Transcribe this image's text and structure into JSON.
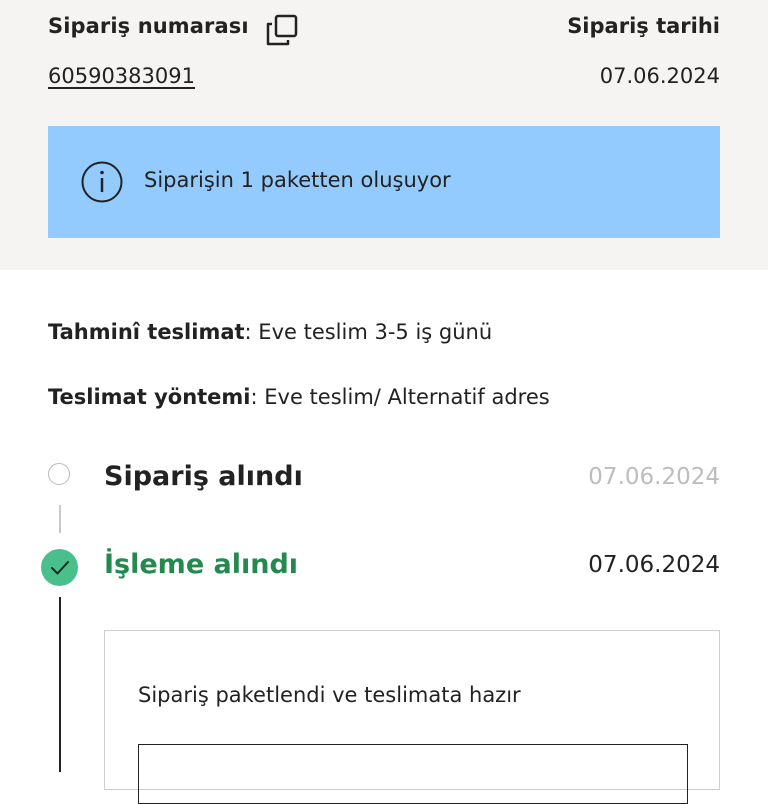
{
  "order": {
    "number_label": "Sipariş numarası",
    "number": "60590383091",
    "date_label": "Sipariş tarihi",
    "date": "07.06.2024"
  },
  "banner": {
    "text": "Siparişin 1 paketten oluşuyor",
    "background": "#93cbff"
  },
  "delivery": {
    "eta_label": "Tahminî teslimat",
    "eta_value": ": Eve teslim 3-5 iş günü",
    "method_label": "Teslimat yöntemi",
    "method_value": ": Eve teslim/ Alternatif adres"
  },
  "timeline": {
    "steps": [
      {
        "title": "Sipariş alındı",
        "date": "07.06.2024",
        "state": "pending",
        "title_color": "#222222",
        "date_color": "#bdbdbd"
      },
      {
        "title": "İşleme alındı",
        "date": "07.06.2024",
        "state": "done",
        "title_color": "#23894f",
        "date_color": "#222222"
      }
    ],
    "detail": {
      "text": "Sipariş paketlendi ve teslimata hazır"
    }
  },
  "colors": {
    "accent_green": "#23894f",
    "check_circle": "#49bf8b",
    "header_background": "#f5f4f2"
  },
  "icons": {
    "copy": "copy-icon",
    "info": "info-icon",
    "check": "check-icon"
  }
}
